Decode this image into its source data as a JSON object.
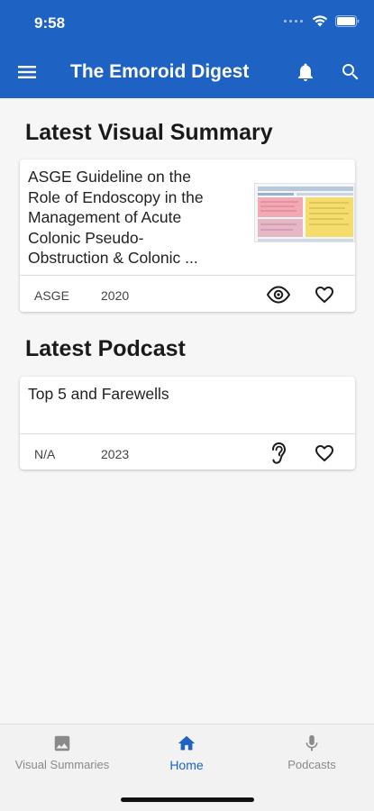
{
  "status_bar": {
    "time": "9:58"
  },
  "app_bar": {
    "title": "The Emoroid Digest",
    "menu_icon": "hamburger-menu-icon",
    "notification_icon": "bell-icon",
    "search_icon": "search-icon"
  },
  "visual_summary": {
    "section_title": "Latest Visual Summary",
    "title_lines": [
      "ASGE Guideline on the",
      "Role of Endoscopy in the",
      "Management of Acute",
      "Colonic Pseudo-",
      "Obstruction & Colonic ..."
    ],
    "source": "ASGE",
    "year": "2020",
    "view_icon": "eye-icon",
    "favorite_icon": "heart-outline-icon"
  },
  "podcast": {
    "section_title": "Latest Podcast",
    "title": "Top 5 and Farewells",
    "source": "N/A",
    "year": "2023",
    "listen_icon": "ear-icon",
    "favorite_icon": "heart-outline-icon"
  },
  "bottom_nav": {
    "items": [
      {
        "label": "Visual Summaries",
        "icon": "image-icon",
        "active": false
      },
      {
        "label": "Home",
        "icon": "home-icon",
        "active": true
      },
      {
        "label": "Podcasts",
        "icon": "microphone-icon",
        "active": false
      }
    ]
  },
  "colors": {
    "primary": "#1e63c4",
    "background": "#f6f6f6",
    "card": "#ffffff",
    "inactive_nav": "#8a8a8a"
  }
}
